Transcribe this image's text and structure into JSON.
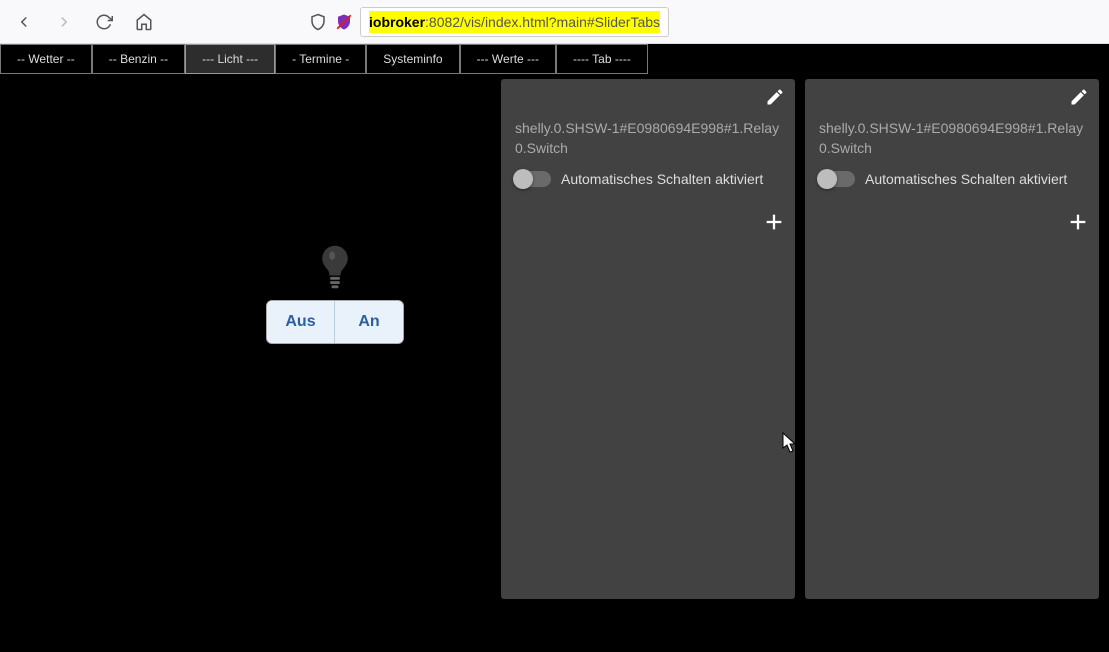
{
  "browser": {
    "url_domain": "iobroker",
    "url_path": ":8082/vis/index.html?main#SliderTabs"
  },
  "tabs": [
    {
      "label": "-- Wetter --"
    },
    {
      "label": "-- Benzin --"
    },
    {
      "label": "--- Licht ---",
      "active": true
    },
    {
      "label": "- Termine -"
    },
    {
      "label": "Systeminfo"
    },
    {
      "label": "--- Werte ---"
    },
    {
      "label": "---- Tab ----"
    }
  ],
  "bulb": {
    "off_label": "Aus",
    "on_label": "An"
  },
  "cards": [
    {
      "title": "shelly.0.SHSW-1#E0980694E998#1.Relay0.Switch",
      "switch_label": "Automatisches Schalten aktiviert",
      "switch_on": false
    },
    {
      "title": "shelly.0.SHSW-1#E0980694E998#1.Relay0.Switch",
      "switch_label": "Automatisches Schalten aktiviert",
      "switch_on": false
    }
  ]
}
